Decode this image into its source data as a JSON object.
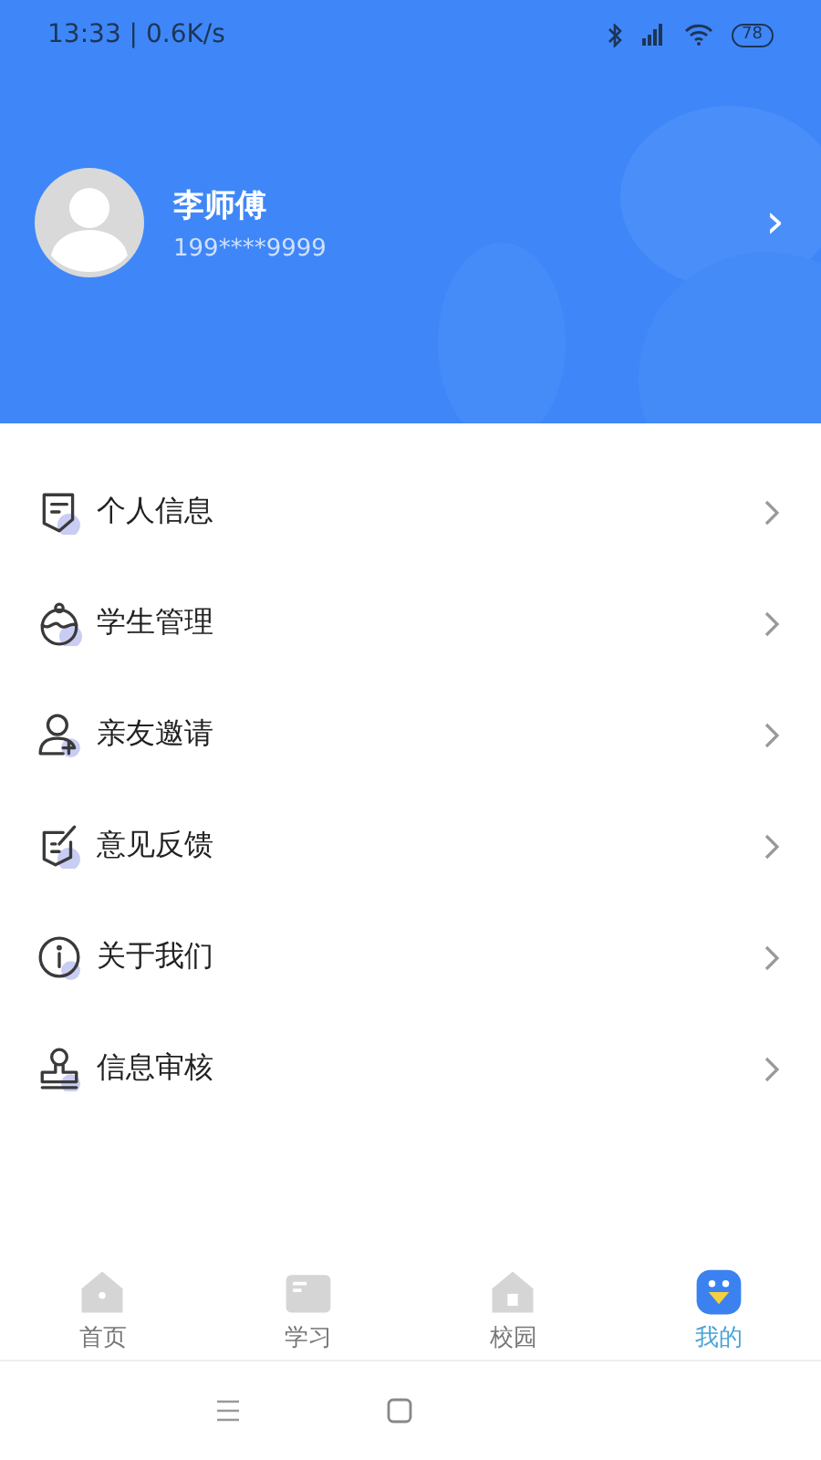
{
  "status_bar": {
    "time": "13:33 | 0.6K/s",
    "battery": "78"
  },
  "profile": {
    "name": "李师傅",
    "phone": "199****9999",
    "chevron": "›"
  },
  "menu": [
    {
      "label": "个人信息"
    },
    {
      "label": "学生管理"
    },
    {
      "label": "亲友邀请"
    },
    {
      "label": "意见反馈"
    },
    {
      "label": "关于我们"
    },
    {
      "label": "信息审核"
    }
  ],
  "tabs": [
    {
      "label": "首页",
      "selected": false
    },
    {
      "label": "学习",
      "selected": false
    },
    {
      "label": "校园",
      "selected": false
    },
    {
      "label": "我的",
      "selected": true
    }
  ]
}
